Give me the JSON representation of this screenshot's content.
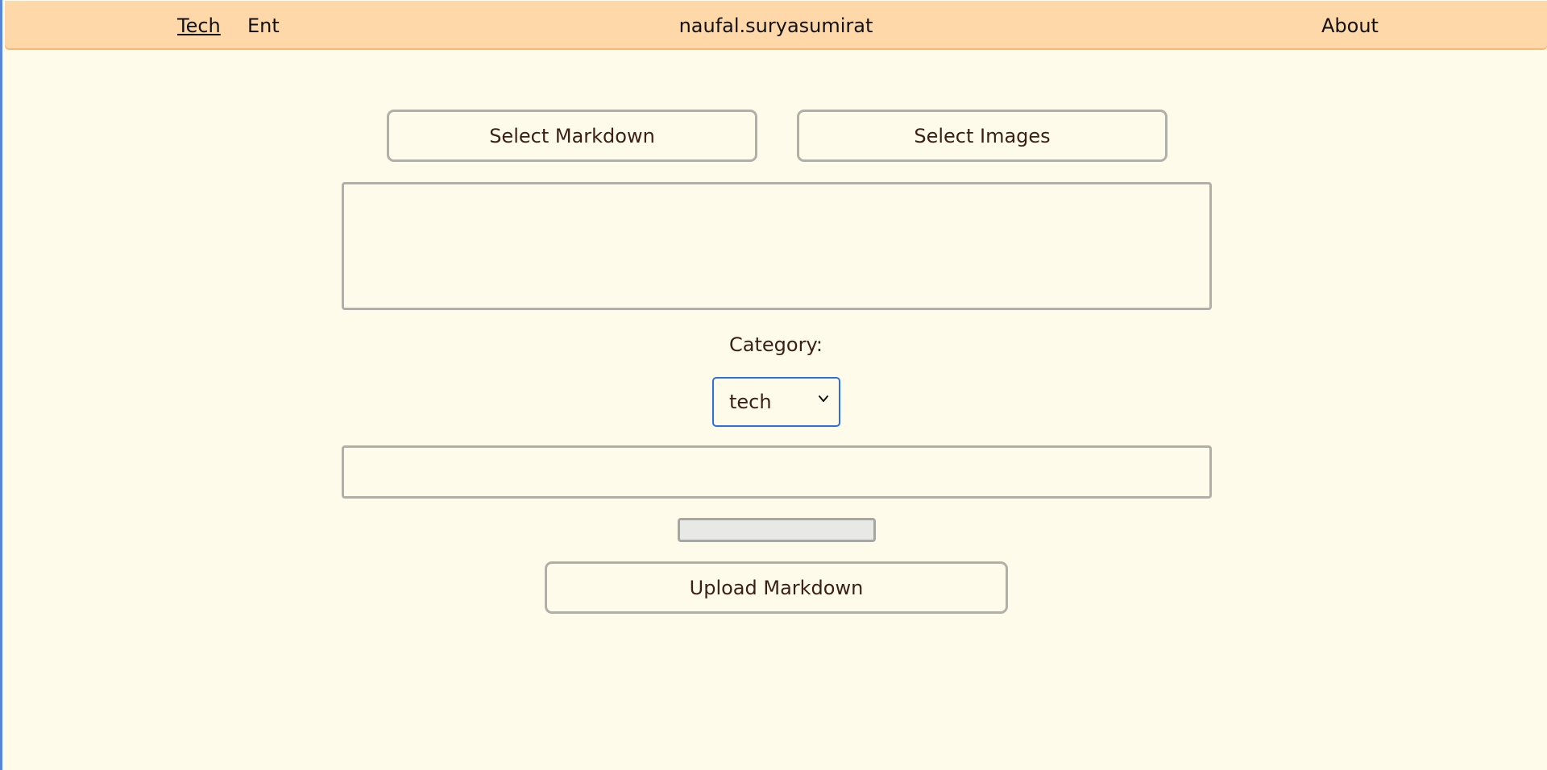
{
  "nav": {
    "links": [
      {
        "label": "Tech"
      },
      {
        "label": "Ent"
      }
    ],
    "brand": "naufal.suryasumirat",
    "about": "About"
  },
  "main": {
    "select_markdown_label": "Select Markdown",
    "select_images_label": "Select Images",
    "markdown_content": "",
    "category_label": "Category:",
    "category_selected": "tech",
    "filename_value": "",
    "upload_progress": 0,
    "upload_label": "Upload Markdown"
  },
  "colors": {
    "page_background": "#fffbeb",
    "navbar_background": "#ffd8a9",
    "text": "#3a1f14",
    "focus_outline": "#2a6ee0",
    "border": "#b0b0a8"
  },
  "icons": {
    "select_arrow": "chevron-down-icon"
  }
}
